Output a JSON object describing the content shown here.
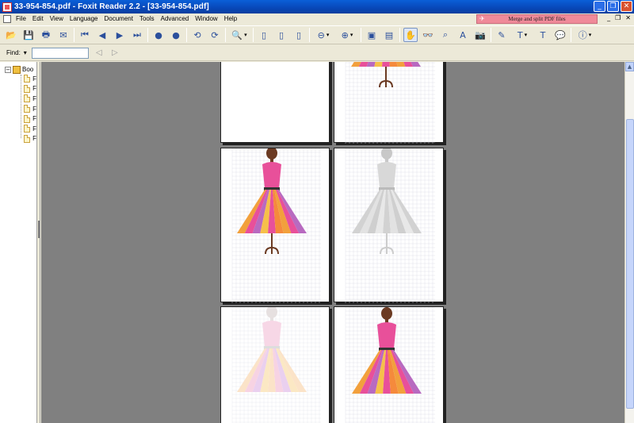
{
  "window": {
    "title": "33-954-854.pdf - Foxit Reader 2.2 - [33-954-854.pdf]",
    "controls": [
      "_",
      "❐",
      "✕"
    ]
  },
  "menubar": {
    "items": [
      "File",
      "Edit",
      "View",
      "Language",
      "Document",
      "Tools",
      "Advanced",
      "Window",
      "Help"
    ],
    "promo": "Merge and split PDF files",
    "doc_controls": [
      "_",
      "❐",
      "✕"
    ]
  },
  "toolbar": {
    "buttons": [
      {
        "name": "open-icon",
        "glyph": "📂"
      },
      {
        "name": "save-icon",
        "glyph": "💾"
      },
      {
        "name": "print-icon",
        "glyph": "🖶"
      },
      {
        "name": "email-icon",
        "glyph": "✉"
      },
      {
        "name": "first-page-icon",
        "glyph": "⏮"
      },
      {
        "name": "previous-page-icon",
        "glyph": "◀"
      },
      {
        "name": "next-page-icon",
        "glyph": "▶"
      },
      {
        "name": "last-page-icon",
        "glyph": "⏭"
      },
      {
        "name": "go-back-icon",
        "glyph": "●"
      },
      {
        "name": "go-forward-icon",
        "glyph": "●"
      },
      {
        "name": "rotate-left-icon",
        "glyph": "⟲"
      },
      {
        "name": "rotate-right-icon",
        "glyph": "⟳"
      },
      {
        "name": "zoom-icon",
        "glyph": "🔍"
      },
      {
        "name": "single-page-icon",
        "glyph": "▯"
      },
      {
        "name": "continuous-page-icon",
        "glyph": "▯"
      },
      {
        "name": "facing-page-icon",
        "glyph": "▯"
      },
      {
        "name": "zoom-out-icon",
        "glyph": "⊖"
      },
      {
        "name": "zoom-in-icon",
        "glyph": "⊕"
      },
      {
        "name": "fit-page-icon",
        "glyph": "▣"
      },
      {
        "name": "fit-width-icon",
        "glyph": "▤"
      },
      {
        "name": "hand-tool-icon",
        "glyph": "✋"
      },
      {
        "name": "loupe-icon",
        "glyph": "👓"
      },
      {
        "name": "find-icon",
        "glyph": "⌕"
      },
      {
        "name": "text-select-icon",
        "glyph": "A"
      },
      {
        "name": "snapshot-icon",
        "glyph": "📷"
      },
      {
        "name": "annotate-icon",
        "glyph": "✎"
      },
      {
        "name": "highlight-icon",
        "glyph": "T"
      },
      {
        "name": "typewriter-icon",
        "glyph": "T"
      },
      {
        "name": "note-icon",
        "glyph": "💬"
      },
      {
        "name": "info-icon",
        "glyph": "ⓘ"
      }
    ]
  },
  "findbar": {
    "label": "Find:",
    "value": "",
    "placeholder": ""
  },
  "sidebar": {
    "root_label": "Boo",
    "items": [
      "F",
      "F",
      "F",
      "F",
      "F",
      "F",
      "F"
    ]
  },
  "colors": {
    "titlebar": "#0847b8",
    "viewer_bg": "#808080",
    "dress_pink": "#e8509a",
    "dress_orange": "#f2a03c",
    "stand_brown": "#6b3a22"
  }
}
